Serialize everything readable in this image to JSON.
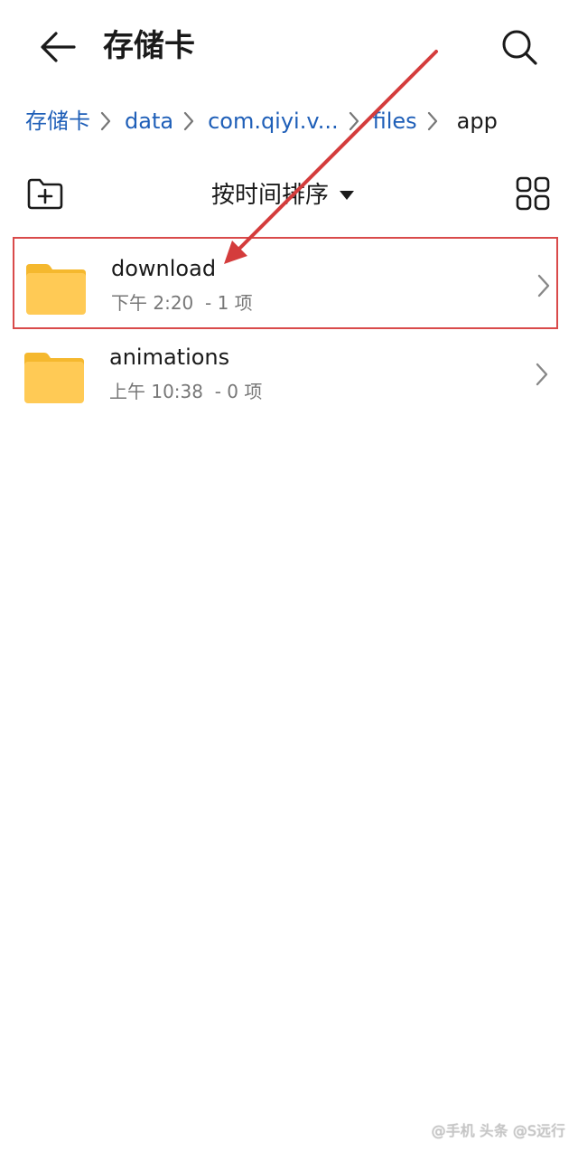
{
  "header": {
    "title": "存储卡"
  },
  "breadcrumb": {
    "items": [
      "存储卡",
      "data",
      "com.qiyi.v...",
      "files",
      "app"
    ]
  },
  "toolbar": {
    "sort_label": "按时间排序"
  },
  "files": [
    {
      "name": "download",
      "time": "下午 2:20",
      "count": "- 1 项",
      "highlighted": true
    },
    {
      "name": "animations",
      "time": "上午 10:38",
      "count": "- 0 项",
      "highlighted": false
    }
  ],
  "colors": {
    "link": "#1f5fb8",
    "folder": "#ffc94d",
    "highlight": "#d94a4a"
  },
  "watermark": "头条 @S远行",
  "watermark_prefix": "@手机"
}
